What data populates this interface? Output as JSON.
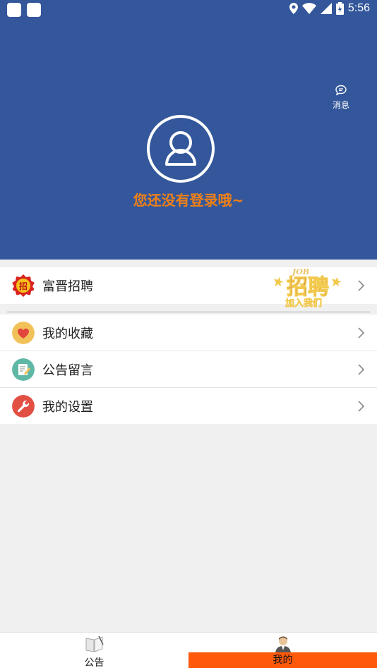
{
  "status_bar": {
    "time": "5:56"
  },
  "header": {
    "message_label": "消息",
    "login_prompt": "您还没有登录哦~"
  },
  "menu": {
    "featured": {
      "label": "富晋招聘",
      "icon": "recruit-badge-icon",
      "promo": {
        "top_text": "JOB",
        "main_text": "招聘",
        "sub_text": "加入我们"
      }
    },
    "items": [
      {
        "label": "我的收藏",
        "icon": "heart-icon"
      },
      {
        "label": "公告留言",
        "icon": "notepad-pencil-icon"
      },
      {
        "label": "我的设置",
        "icon": "wrench-icon"
      }
    ]
  },
  "bottom_nav": {
    "tabs": [
      {
        "label": "公告",
        "icon": "notice-book-icon"
      },
      {
        "label": "我的",
        "icon": "user-avatar-icon",
        "active": true
      }
    ]
  },
  "colors": {
    "header_bg": "#33579a",
    "accent_orange": "#f08018",
    "active_tab": "#ff5a0a"
  }
}
